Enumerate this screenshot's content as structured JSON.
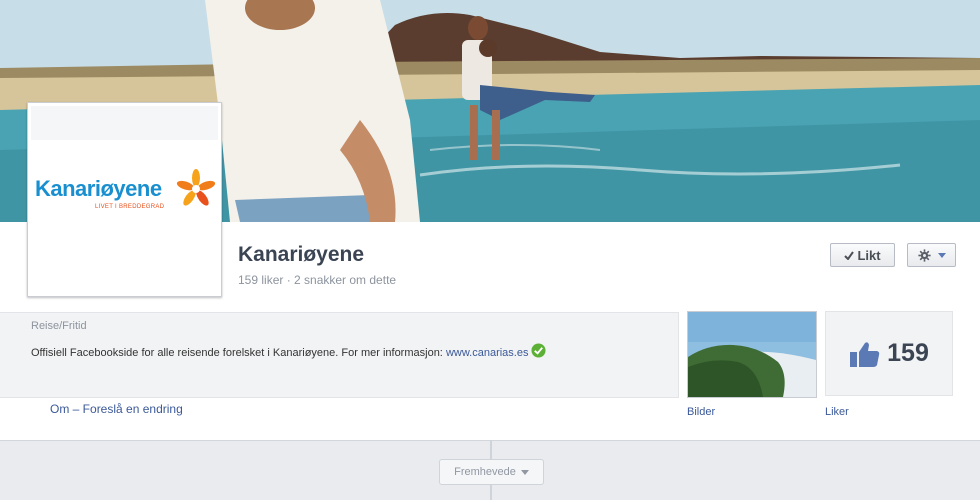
{
  "cover": {
    "description_icon": "cover-photo"
  },
  "profile": {
    "logo_text": "Kanariøyene",
    "logo_tagline": "LIVET I BREDDEGRAD"
  },
  "page": {
    "title": "Kanariøyene",
    "subtitle": "159 liker · 2 snakker om dette"
  },
  "actions": {
    "liked_label": "Likt",
    "liked_icon": "check-icon",
    "settings_icon": "gear-icon"
  },
  "about": {
    "category": "Reise/Fritid",
    "description": "Offisiell Facebookside for alle reisende forelsket i Kanariøyene. For mer informasjon: ",
    "link": "www.canarias.es",
    "about_link": "Om",
    "suggest_link": " – Foreslå en endring"
  },
  "apps": {
    "photos_label": "Bilder",
    "likes_label": "Liker",
    "likes_count": "159"
  },
  "timeline": {
    "featured_label": "Fremhevede"
  },
  "colors": {
    "link": "#3b5998",
    "title": "#3b4453",
    "logo_blue": "#1a8fd0",
    "logo_orange": "#e8501c"
  }
}
